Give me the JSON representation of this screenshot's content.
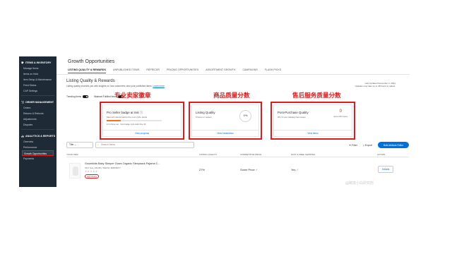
{
  "sidebar": {
    "sections": [
      {
        "title": "ITEMS & INVENTORY",
        "icon": "tag-icon",
        "items": [
          "Manage Items",
          "Items on Hold",
          "Item Setup & Maintenance",
          "Feed Status",
          "CAP Settings"
        ]
      },
      {
        "title": "ORDER MANAGEMENT",
        "icon": "cart-icon",
        "items": [
          "Orders",
          "Returns & Refunds",
          "Adjustments",
          "Disputes"
        ]
      },
      {
        "title": "ANALYTICS & REPORTS",
        "icon": "chart-icon",
        "items": [
          "Overview",
          "Performance",
          "Growth Opportunities",
          "Payments"
        ],
        "active_item": "Growth Opportunities"
      }
    ]
  },
  "page_title": "Growth Opportunities",
  "tabs": [
    {
      "label": "LISTING QUALITY & REWARDS",
      "active": true
    },
    {
      "label": "UNPUBLISHED ITEMS"
    },
    {
      "label": "REPRICER"
    },
    {
      "label": "PRICING OPPORTUNITIES"
    },
    {
      "label": "ASSORTMENT GROWTH"
    },
    {
      "label": "CAMPAIGNS"
    },
    {
      "label": "FLASH PICKS"
    }
  ],
  "section": {
    "title": "Listing Quality & Rewards",
    "description": "Listing quality provides you with insights on how customers view your published items.",
    "learn_more": "Learn more",
    "last_updated_line1": "Last Updated November 2, 2021",
    "last_updated_line2": "Updates may take up to 48 hours to reflect."
  },
  "toggles": [
    {
      "label": "Trending Items"
    },
    {
      "label": "Walmart Fulfilled Items"
    }
  ],
  "cards": {
    "pro_seller": {
      "title": "Pro Seller badge at risk",
      "subtitle": "Meet all criteria before the next cycle starts",
      "progress": 0.25,
      "note": "1/4 criteria met · Next badge cycle starts Nov 30",
      "link": "View progress",
      "cn_label": "专业卖家徽章"
    },
    "listing_quality": {
      "title": "Listing Quality",
      "subtitle": "0 items to review",
      "score": "0%",
      "link": "View breakdown",
      "cn_label": "商品质量分数"
    },
    "post_purchase": {
      "title": "Post-Purchase Quality",
      "subtitle": "0% of your catalog has issues",
      "count": "0",
      "count_sub": "items with issues",
      "link": "View items",
      "cn_label": "售后服务质量分数"
    }
  },
  "filters": {
    "title_dropdown": "Title",
    "search_placeholder": "Search Items",
    "filter_label": "Filter",
    "export_label": "Export",
    "bulk_button": "Bulk Attribute Editor"
  },
  "table": {
    "headers": [
      "YOUR ITEM",
      "LISTING QUALITY",
      "COMPETITIVE PRICE",
      "FAST & FREE SHIPPING",
      "ACTION"
    ],
    "rows": [
      {
        "name": "Goumikids Baby Sleeper Gown Organic Sleepsack Pajama C...",
        "meta": "SKU: Sun_SKU45  |  ITEM ID: 806645277",
        "stars": "★★★★★",
        "badge": "High Priority",
        "listing_quality": "27%",
        "competitive_price": "Some Price",
        "shipping": "Yes",
        "action": "Details"
      }
    ]
  },
  "watermark": "@跨境小白研究所",
  "colors": {
    "accent": "#0071dc",
    "highlight": "#e11b1b",
    "sidebar": "#1e2a35",
    "progress": "#f47321"
  }
}
